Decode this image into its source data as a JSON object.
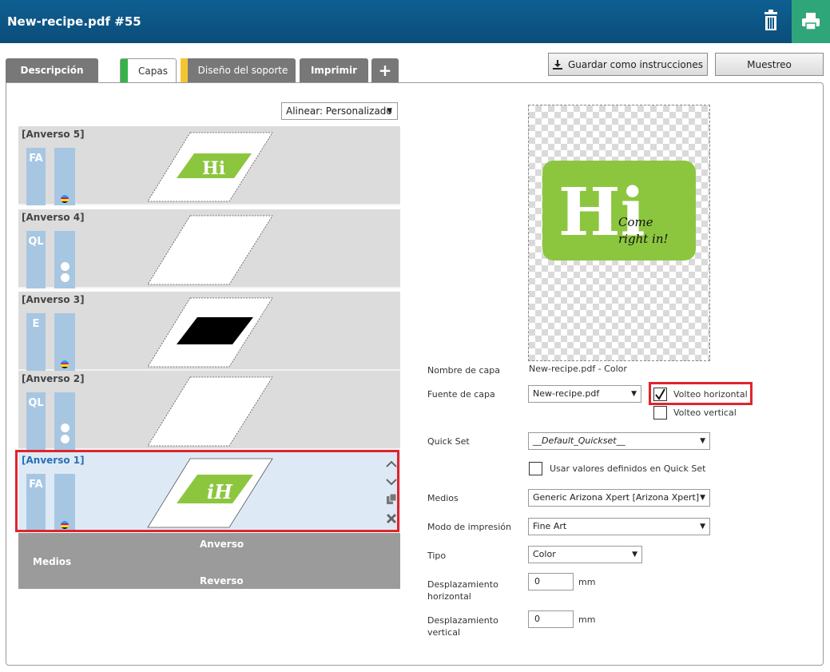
{
  "header": {
    "title": "New-recipe.pdf #55",
    "trash_icon": "trash-icon",
    "print_icon": "printer-icon",
    "print_color": "#2fa67a"
  },
  "tabs": [
    {
      "label": "Descripción"
    },
    {
      "label": "Capas",
      "stripe": "#35b34a"
    },
    {
      "label": "Diseño del soporte",
      "stripe": "#f4c531"
    },
    {
      "label": "Imprimir"
    }
  ],
  "buttons": {
    "save": "Guardar como instrucciones",
    "muestreo": "Muestreo"
  },
  "align": {
    "value": "Alinear: Personalizado"
  },
  "layers": [
    {
      "name": "[Anverso 5]",
      "code": "FA"
    },
    {
      "name": "[Anverso 4]",
      "code": "QL"
    },
    {
      "name": "[Anverso 3]",
      "code": "E"
    },
    {
      "name": "[Anverso 2]",
      "code": "QL"
    },
    {
      "name": "[Anverso 1]",
      "code": "FA"
    }
  ],
  "thumb": {
    "hi": "Hi",
    "hi_mirror": "iH"
  },
  "medios": {
    "label": "Medios",
    "front": "Anverso",
    "back": "Reverso"
  },
  "preview": {
    "big": "Hi",
    "line1": "Come",
    "line2": "right in!",
    "logo_color": "#8cc63f"
  },
  "form": {
    "layer_name_label": "Nombre de capa",
    "layer_name_value": "New-recipe.pdf - Color",
    "source_label": "Fuente de capa",
    "source_value": "New-recipe.pdf",
    "flip_h": "Volteo horizontal",
    "flip_v": "Volteo vertical",
    "quickset_label": "Quick Set",
    "quickset_value": "__Default_Quickset__",
    "use_quickset": "Usar valores definidos en Quick Set",
    "media_label": "Medios",
    "media_value": "Generic Arizona Xpert [Arizona Xpert]",
    "mode_label": "Modo de impresión",
    "mode_value": "Fine Art",
    "type_label": "Tipo",
    "type_value": "Color",
    "offset_h_label_1": "Desplazamiento",
    "offset_h_label_2": "horizontal",
    "offset_h_value": "0",
    "offset_v_label_1": "Desplazamiento",
    "offset_v_label_2": "vertical",
    "offset_v_value": "0",
    "unit": "mm"
  }
}
